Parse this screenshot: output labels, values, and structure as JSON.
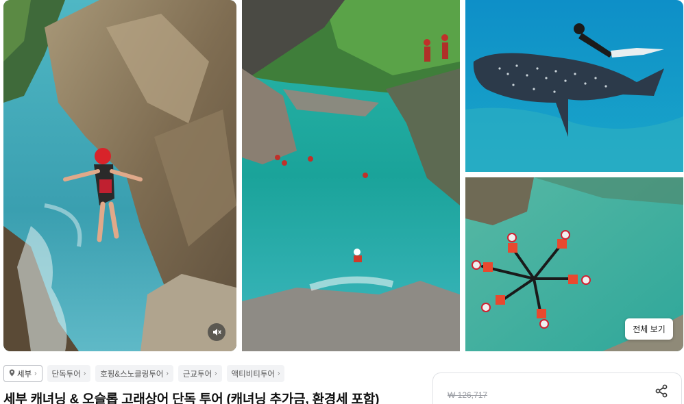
{
  "gallery": {
    "photos": [
      {
        "name": "cliff-jump-photo"
      },
      {
        "name": "canyon-swim-photo"
      },
      {
        "name": "whale-shark-photo"
      },
      {
        "name": "group-float-photo"
      }
    ],
    "mute_icon": "speaker-muted-icon",
    "view_all_label": "전체 보기"
  },
  "tags": [
    {
      "label": "세부",
      "icon": "location-pin-icon",
      "type": "location"
    },
    {
      "label": "단독투어"
    },
    {
      "label": "호핑&스노클링투어"
    },
    {
      "label": "근교투어"
    },
    {
      "label": "액티비티투어"
    }
  ],
  "product": {
    "title": "세부 캐녀닝 & 오슬롭 고래상어 단독 투어 (캐녀닝 추가금, 환경세 포함)",
    "original_price": "₩ 126,717",
    "share_icon": "share-icon"
  }
}
